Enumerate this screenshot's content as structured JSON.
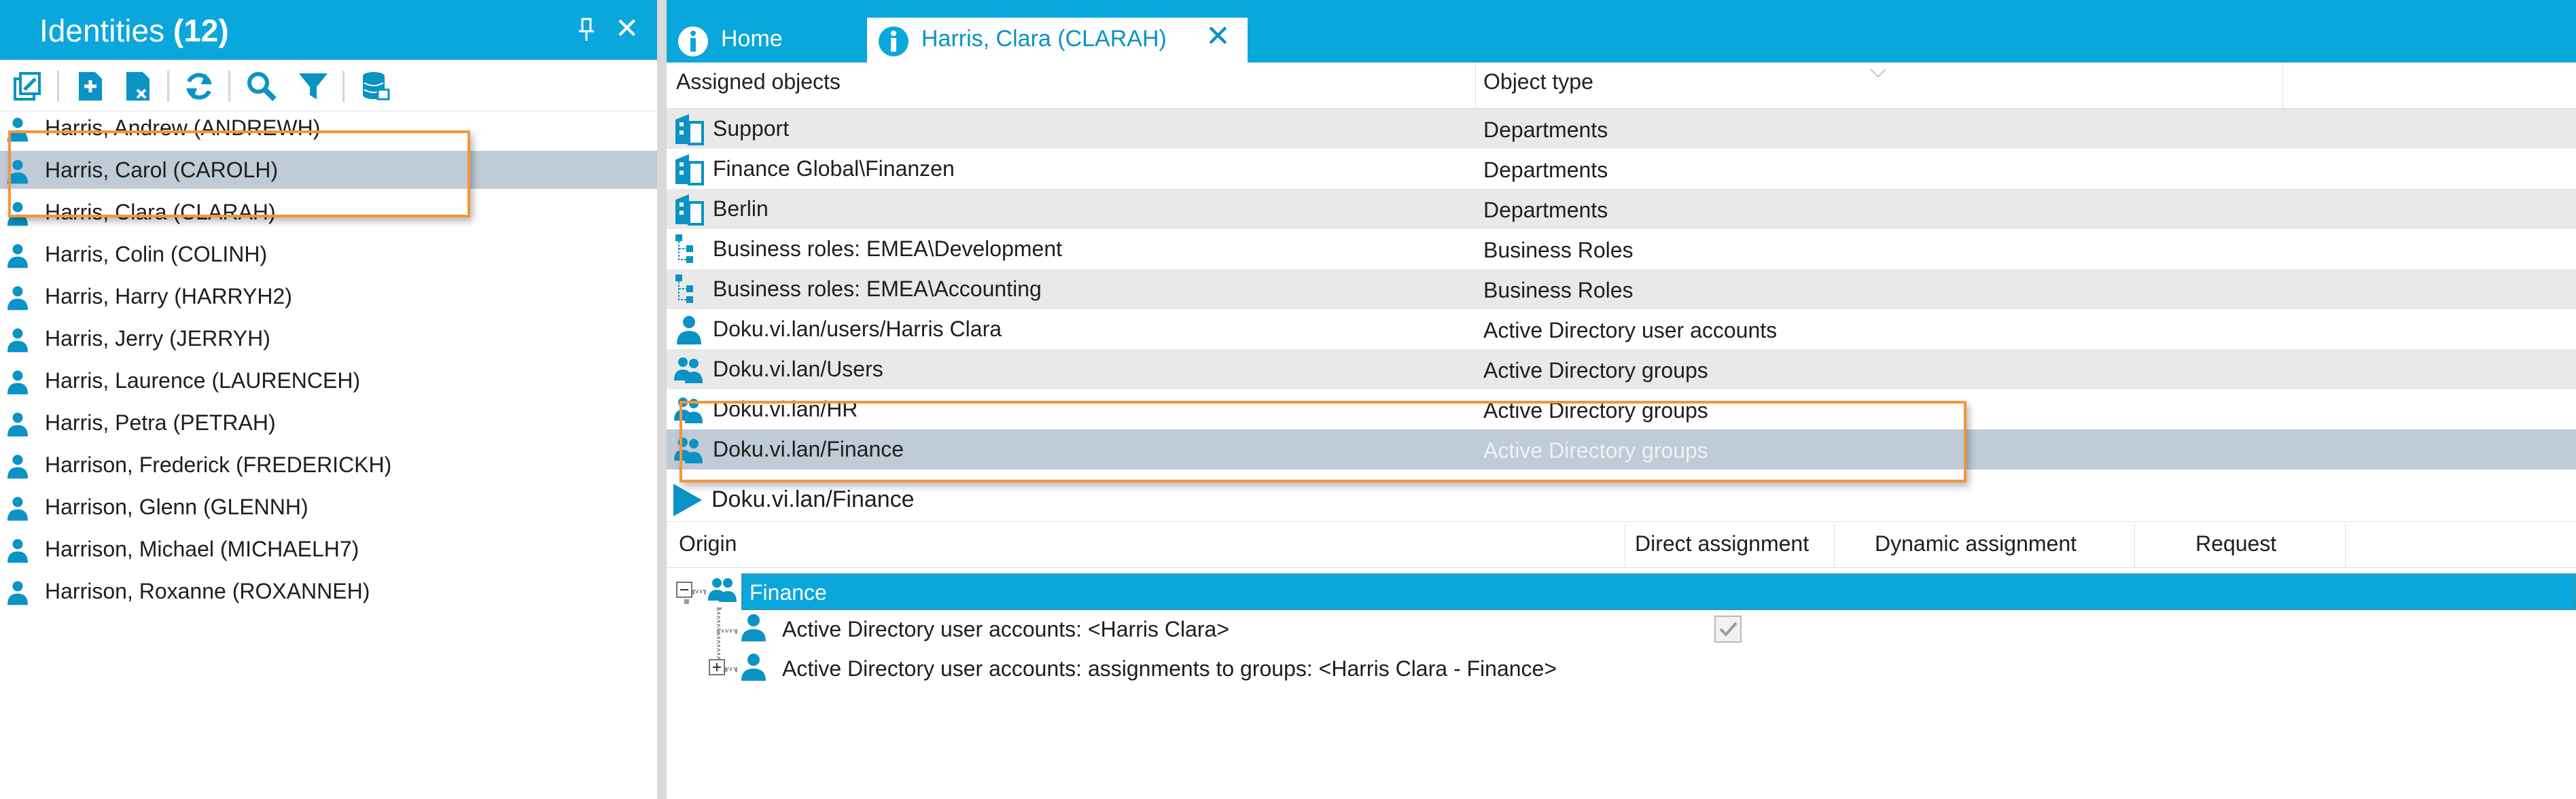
{
  "left_panel": {
    "title": "Identities",
    "count": "(12)",
    "close_label": "✕",
    "identities": [
      {
        "label": "Harris, Andrew (ANDREWH)",
        "selected": false
      },
      {
        "label": "Harris, Carol (CAROLH)",
        "selected": true
      },
      {
        "label": "Harris, Clara (CLARAH)",
        "selected": false
      },
      {
        "label": "Harris, Colin (COLINH)",
        "selected": false
      },
      {
        "label": "Harris, Harry (HARRYH2)",
        "selected": false
      },
      {
        "label": "Harris, Jerry (JERRYH)",
        "selected": false
      },
      {
        "label": "Harris, Laurence (LAURENCEH)",
        "selected": false
      },
      {
        "label": "Harris, Petra (PETRAH)",
        "selected": false
      },
      {
        "label": "Harrison, Frederick (FREDERICKH)",
        "selected": false
      },
      {
        "label": "Harrison, Glenn (GLENNH)",
        "selected": false
      },
      {
        "label": "Harrison, Michael (MICHAELH7)",
        "selected": false
      },
      {
        "label": "Harrison, Roxanne (ROXANNEH)",
        "selected": false
      }
    ],
    "toolbar_icons": [
      "multi-edit-icon",
      "new-icon",
      "delete-icon",
      "refresh-icon",
      "search-icon",
      "filter-icon",
      "database-icon"
    ]
  },
  "tabs": [
    {
      "label": "Home",
      "active": false
    },
    {
      "label": "Harris, Clara (CLARAH)",
      "active": true,
      "close_label": "✕"
    }
  ],
  "assigned_grid": {
    "columns": [
      "Assigned objects",
      "Object type"
    ],
    "rows": [
      {
        "name": "Support",
        "type": "Departments",
        "icon": "department-icon"
      },
      {
        "name": "Finance Global\\Finanzen",
        "type": "Departments",
        "icon": "department-icon"
      },
      {
        "name": "Berlin",
        "type": "Departments",
        "icon": "department-icon"
      },
      {
        "name": "Business roles: EMEA\\Development",
        "type": "Business Roles",
        "icon": "business-role-icon"
      },
      {
        "name": "Business roles: EMEA\\Accounting",
        "type": "Business Roles",
        "icon": "business-role-icon"
      },
      {
        "name": "Doku.vi.lan/users/Harris Clara",
        "type": "Active Directory user accounts",
        "icon": "user-account-icon"
      },
      {
        "name": "Doku.vi.lan/Users",
        "type": "Active Directory groups",
        "icon": "group-icon"
      },
      {
        "name": "Doku.vi.lan/HR",
        "type": "Active Directory groups",
        "icon": "group-icon"
      },
      {
        "name": "Doku.vi.lan/Finance",
        "type": "Active Directory groups",
        "icon": "group-icon"
      }
    ],
    "selected_index": 8
  },
  "detail": {
    "title": "Doku.vi.lan/Finance",
    "columns": [
      "Origin",
      "Direct assignment",
      "Dynamic assignment",
      "Request"
    ],
    "tree": {
      "root": "Finance",
      "children": [
        {
          "label": "Active Directory user accounts: <Harris Clara>",
          "direct_assignment": true
        },
        {
          "label": "Active Directory user accounts: assignments to groups: <Harris Clara - Finance>",
          "direct_assignment": false
        }
      ]
    }
  },
  "colors": {
    "accent": "#0aa7dc",
    "selection": "#bfcbd6",
    "highlight": "#f3953d"
  }
}
